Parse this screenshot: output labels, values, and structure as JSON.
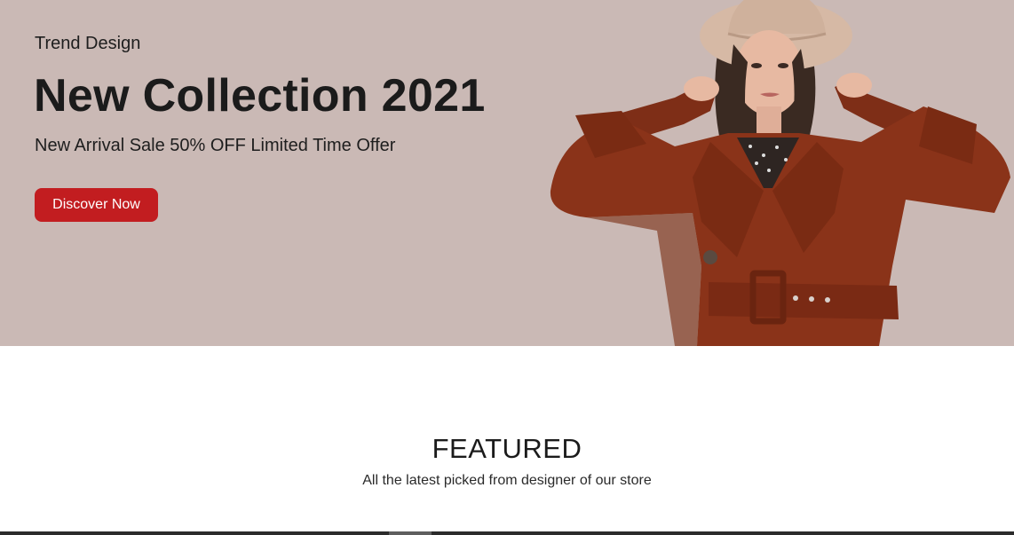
{
  "hero": {
    "eyebrow": "Trend Design",
    "title": "New Collection 2021",
    "subtitle": "New Arrival Sale 50% OFF Limited Time Offer",
    "cta_label": "Discover Now",
    "background_color": "#cab9b5",
    "cta_color": "#c21d20",
    "image_subject": "model-in-brown-trench-coat-and-hat"
  },
  "featured": {
    "title": "FEATURED",
    "subtitle": "All the latest picked from designer of our store"
  }
}
